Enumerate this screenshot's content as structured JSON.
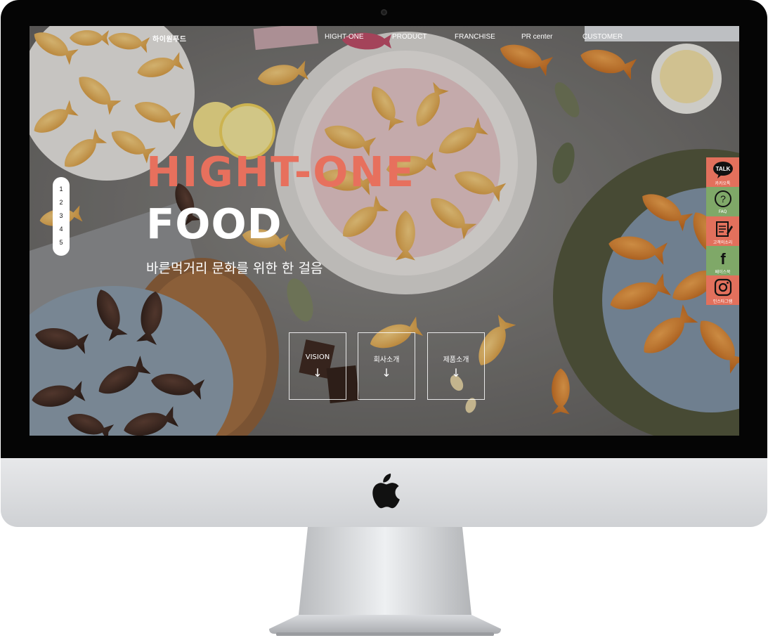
{
  "site": {
    "logo": "하이원푸드"
  },
  "nav": {
    "items": [
      {
        "label": "HIGHT-ONE",
        "id": "hight-one"
      },
      {
        "label": "PRODUCT",
        "id": "product"
      },
      {
        "label": "FRANCHISE",
        "id": "franchise"
      },
      {
        "label": "PR center",
        "id": "pr-center"
      },
      {
        "label": "CUSTOMER",
        "id": "customer"
      }
    ]
  },
  "pager": {
    "items": [
      "1",
      "2",
      "3",
      "4",
      "5"
    ]
  },
  "hero": {
    "title_line1": "HIGHT-ONE",
    "title_line2": "FOOD",
    "subtitle": "바른먹거리 문화를 위한 한 걸음",
    "title_color": "#e7705d"
  },
  "boxes": [
    {
      "label": "VISION",
      "arrow": "↓"
    },
    {
      "label": "회사소개",
      "arrow": "↓"
    },
    {
      "label": "제품소개",
      "arrow": "↓"
    }
  ],
  "side_menu": [
    {
      "label": "카카오톡",
      "icon": "talk-icon",
      "icon_text": "TALK",
      "color": "#e2705c"
    },
    {
      "label": "FAQ",
      "icon": "question-icon",
      "icon_text": "?",
      "color": "#7fa868"
    },
    {
      "label": "고객의소리",
      "icon": "notepad-icon",
      "icon_text": "",
      "color": "#e2705c"
    },
    {
      "label": "페이스북",
      "icon": "facebook-icon",
      "icon_text": "f",
      "color": "#7fa868"
    },
    {
      "label": "인스타그램",
      "icon": "instagram-icon",
      "icon_text": "",
      "color": "#e2705c"
    }
  ]
}
